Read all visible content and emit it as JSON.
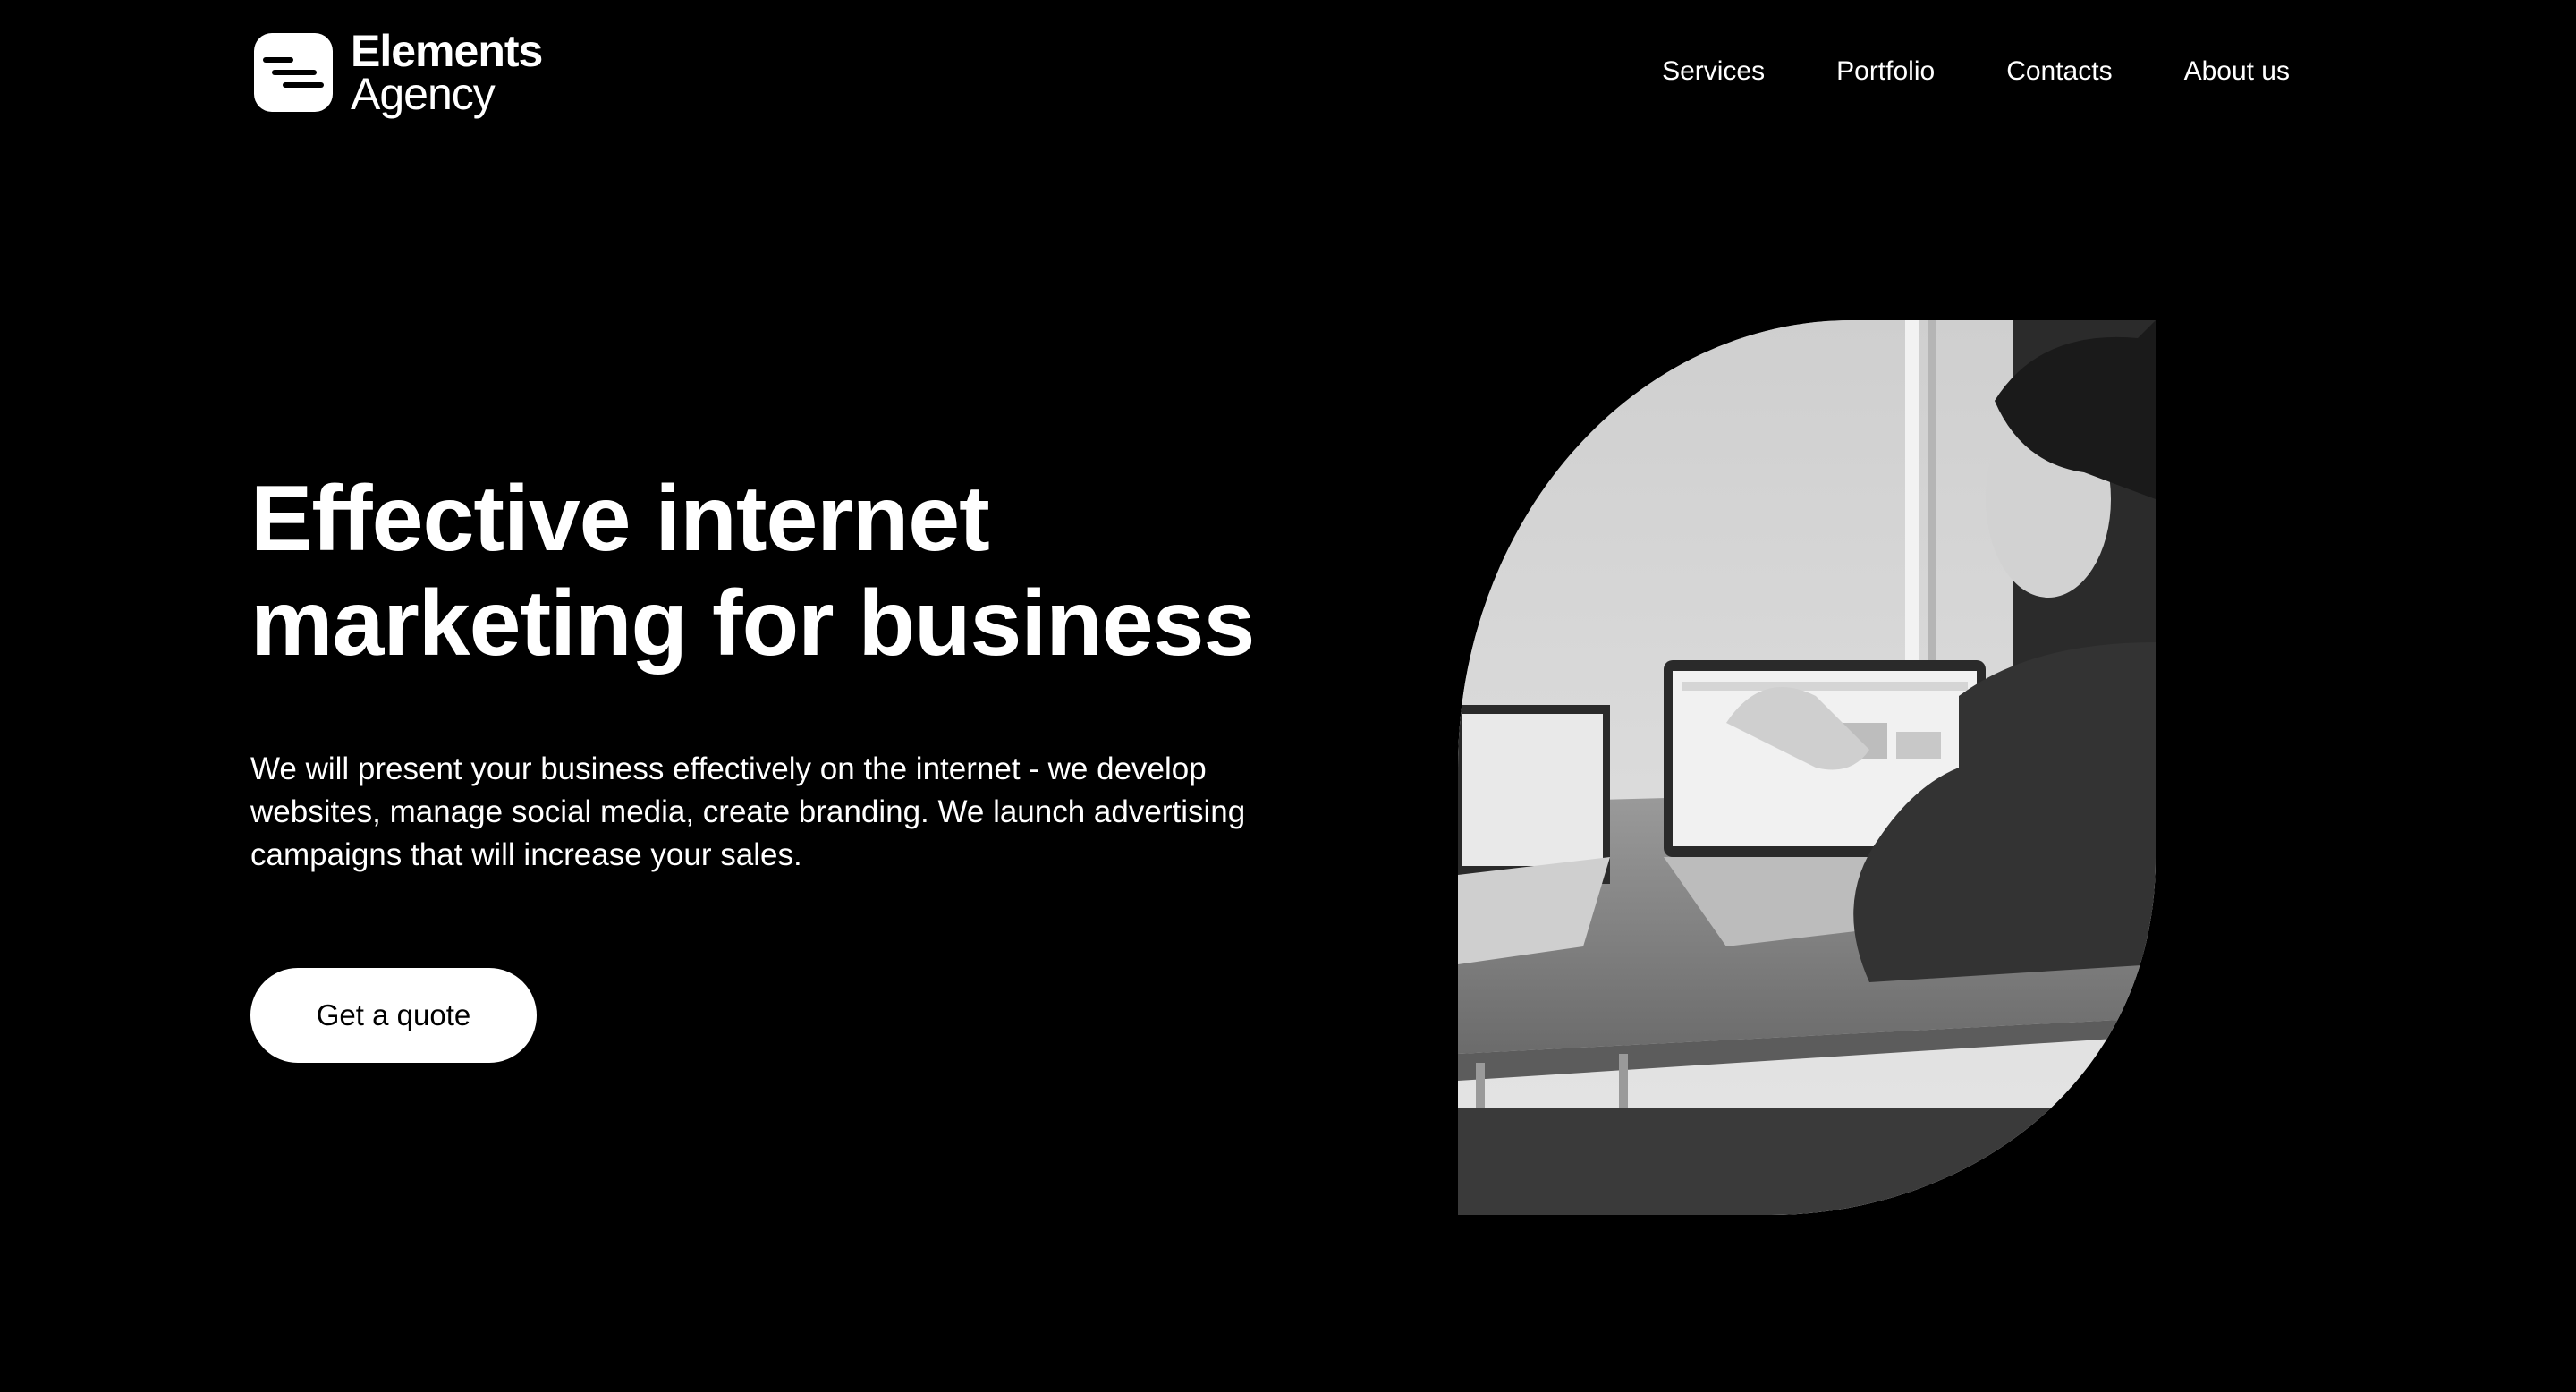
{
  "header": {
    "logo": {
      "line1": "Elements",
      "line2": "Agency",
      "icon": "elements-logo-icon"
    },
    "nav": [
      {
        "label": "Services"
      },
      {
        "label": "Portfolio"
      },
      {
        "label": "Contacts"
      },
      {
        "label": "About us"
      }
    ]
  },
  "hero": {
    "title_line1": "Effective internet",
    "title_line2": "marketing for business",
    "description": "We will present your business effectively on the internet - we develop websites, manage social media, create branding. We launch advertising campaigns that will increase your sales.",
    "cta_label": "Get a quote",
    "image": "man-with-laptops-photo"
  },
  "colors": {
    "background": "#000000",
    "text": "#ffffff",
    "button_bg": "#ffffff",
    "button_text": "#000000"
  }
}
